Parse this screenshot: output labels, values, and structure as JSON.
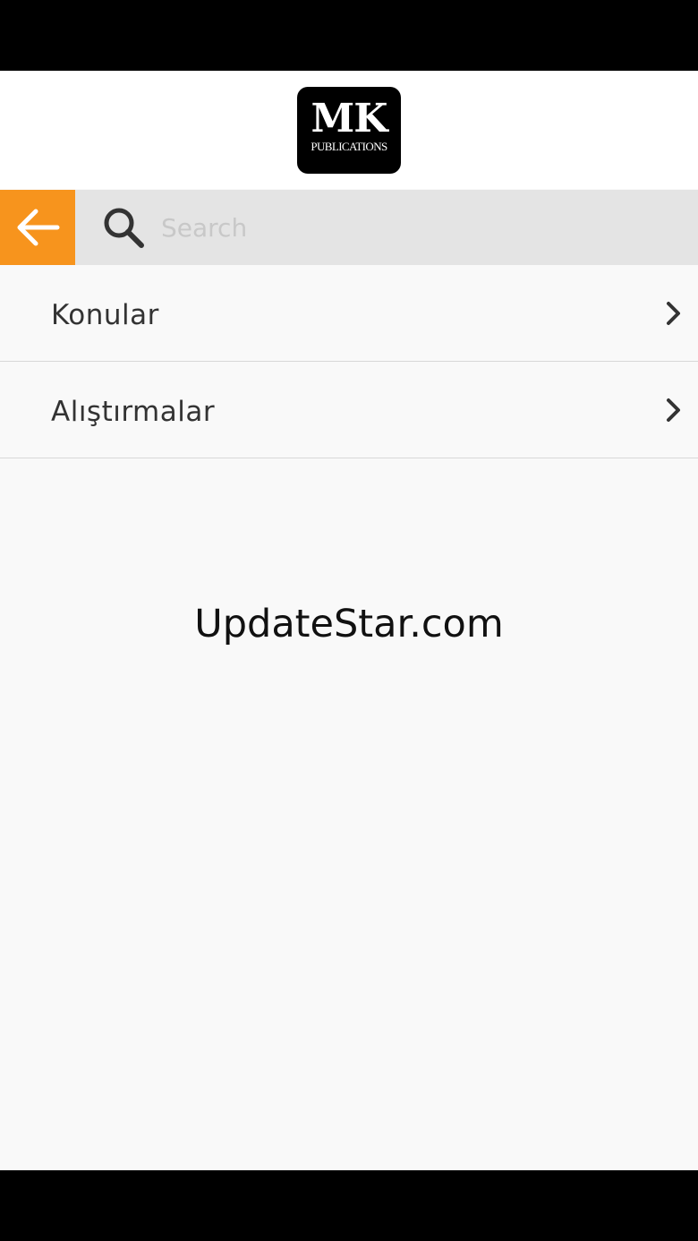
{
  "header": {
    "logo": {
      "main_text": "MK",
      "sub_text": "PUBLICATIONS"
    }
  },
  "search": {
    "back_icon": "arrow-left-icon",
    "search_icon": "magnifier-icon",
    "placeholder": "Search",
    "value": ""
  },
  "menu": {
    "items": [
      {
        "label": "Konular",
        "icon": "chevron-right-icon"
      },
      {
        "label": "Alıştırmalar",
        "icon": "chevron-right-icon"
      }
    ]
  },
  "watermark": {
    "text": "UpdateStar.com"
  },
  "colors": {
    "accent": "#f7941d",
    "search_bar": "#e4e4e4",
    "background": "#f9f9f9",
    "system_bars": "#000000"
  }
}
